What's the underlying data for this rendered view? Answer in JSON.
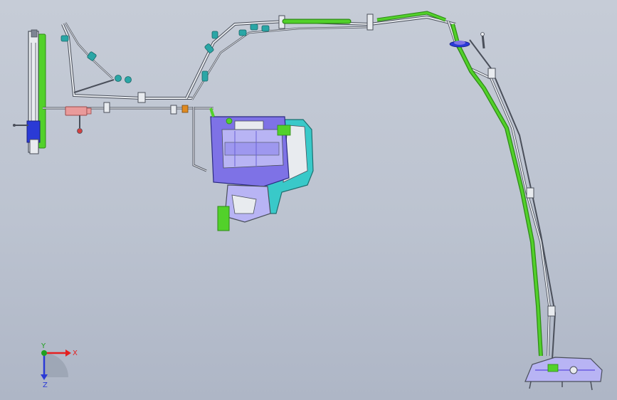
{
  "colors": {
    "background_top": "#c6ccd7",
    "background_bottom": "#aeb6c6",
    "pipe_outline": "#4a4f5a",
    "pipe_fill": "#e8ebef",
    "hose_green": "#52d12a",
    "hose_green_dark": "#2e8a16",
    "module_blue": "#7e72e6",
    "module_light": "#b8b4f4",
    "housing_cyan": "#39c9c9",
    "clip_teal": "#2aa6a6",
    "connector_pink": "#e99a9a",
    "fitting_orange": "#e08a20",
    "axis_x_color": "#e52020",
    "axis_y_color": "#20a020",
    "axis_z_color": "#2a3ad6"
  },
  "icons": {
    "axis_triad": "xyz-triad-icon"
  },
  "triad": {
    "x_label": "X",
    "y_label": "Y",
    "z_label": "Z"
  }
}
